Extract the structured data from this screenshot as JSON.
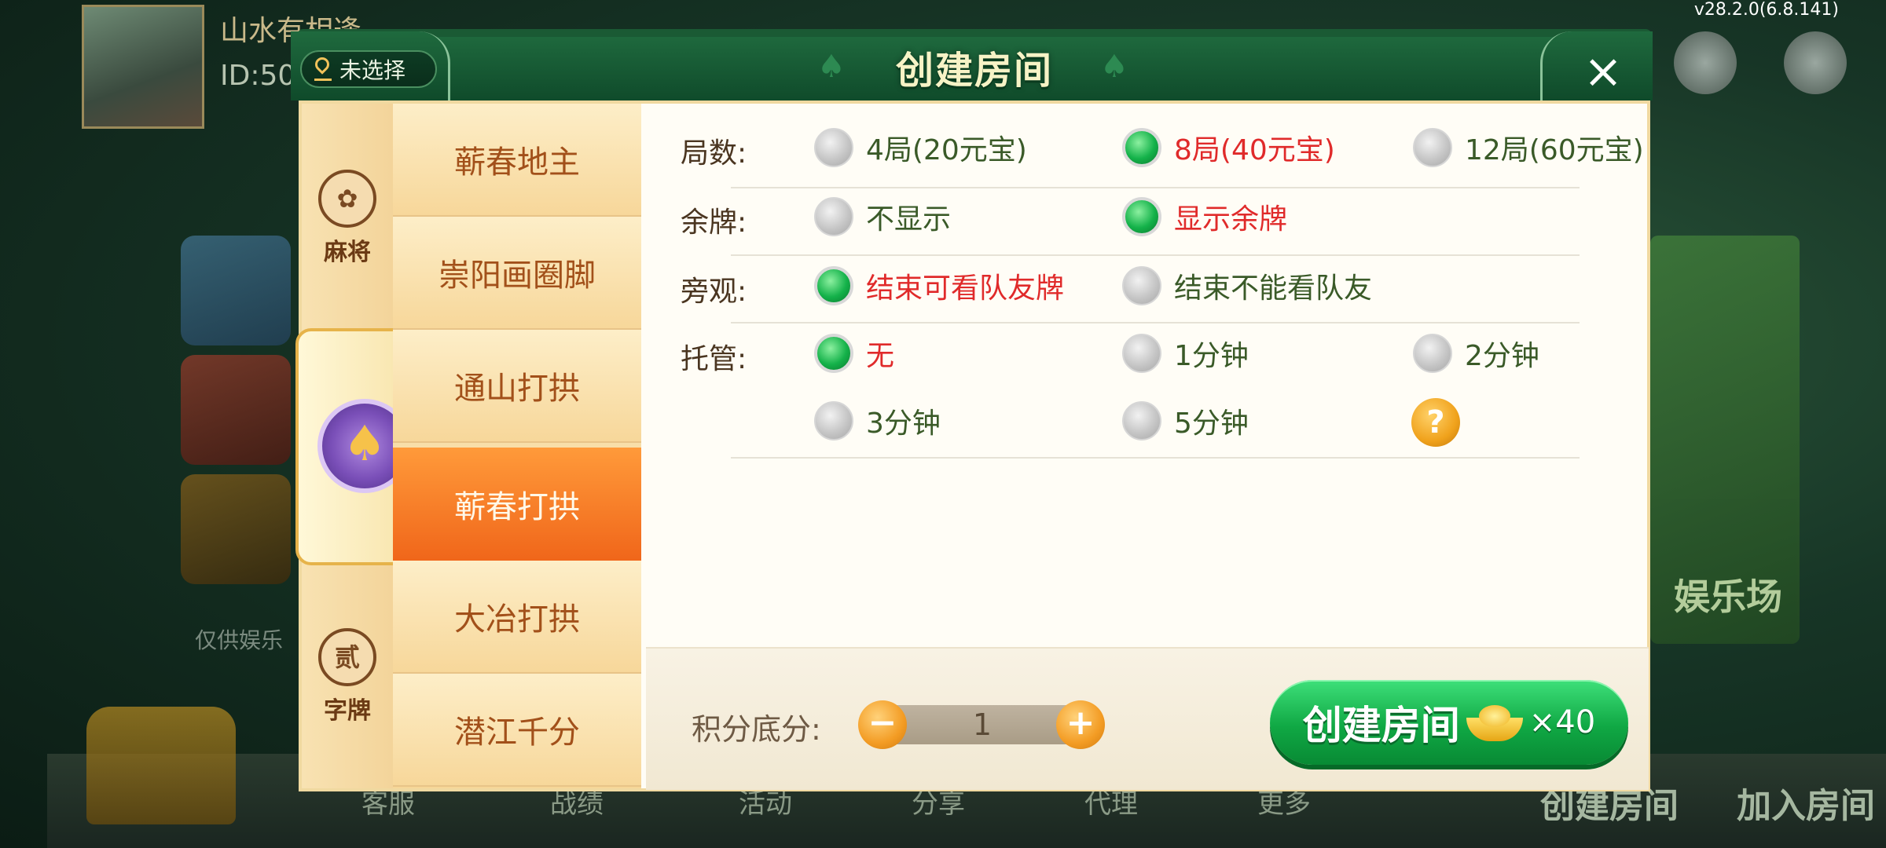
{
  "background": {
    "user_name": "山水有相逢",
    "user_id": "ID:50",
    "notice": "仅供娱乐",
    "side_panel_text": "娱乐场",
    "bottom_items": [
      "客服",
      "战绩",
      "活动",
      "分享",
      "代理",
      "更多"
    ],
    "bottom_create": "创建房间",
    "bottom_join": "加入房间",
    "version": "v28.2.0(6.8.141)"
  },
  "dialog": {
    "title": "创建房间",
    "location": "未选择",
    "close_label": "×"
  },
  "categories": [
    {
      "label": "麻将",
      "icon_char": "✿"
    },
    {
      "label": "",
      "icon_char": "♠"
    },
    {
      "label": "字牌",
      "icon_char": "贰"
    }
  ],
  "games": [
    {
      "label": "蕲春地主",
      "active": false
    },
    {
      "label": "崇阳画圈脚",
      "active": false
    },
    {
      "label": "通山打拱",
      "active": false
    },
    {
      "label": "蕲春打拱",
      "active": true
    },
    {
      "label": "大冶打拱",
      "active": false
    },
    {
      "label": "潜江千分",
      "active": false
    }
  ],
  "options": {
    "rounds": {
      "label": "局数:",
      "choices": [
        "4局(20元宝)",
        "8局(40元宝)",
        "12局(60元宝)"
      ],
      "selected": "8局(40元宝)"
    },
    "remaining": {
      "label": "余牌:",
      "choices": [
        "不显示",
        "显示余牌"
      ],
      "selected": "显示余牌"
    },
    "spectate": {
      "label": "旁观:",
      "choices": [
        "结束可看队友牌",
        "结束不能看队友"
      ],
      "selected": "结束可看队友牌"
    },
    "hosting": {
      "label": "托管:",
      "choices": [
        "无",
        "1分钟",
        "2分钟",
        "3分钟",
        "5分钟"
      ],
      "selected": "无"
    },
    "help_label": "?"
  },
  "footer": {
    "score_label": "积分底分:",
    "score_value": "1",
    "minus_label": "−",
    "plus_label": "+",
    "create_label": "创建房间",
    "cost_label": "×40"
  },
  "colors": {
    "selected_text": "#e02a2a",
    "unselected_text": "#3a5a28",
    "active_game": "#f0661a",
    "create_button": "#10a844"
  }
}
